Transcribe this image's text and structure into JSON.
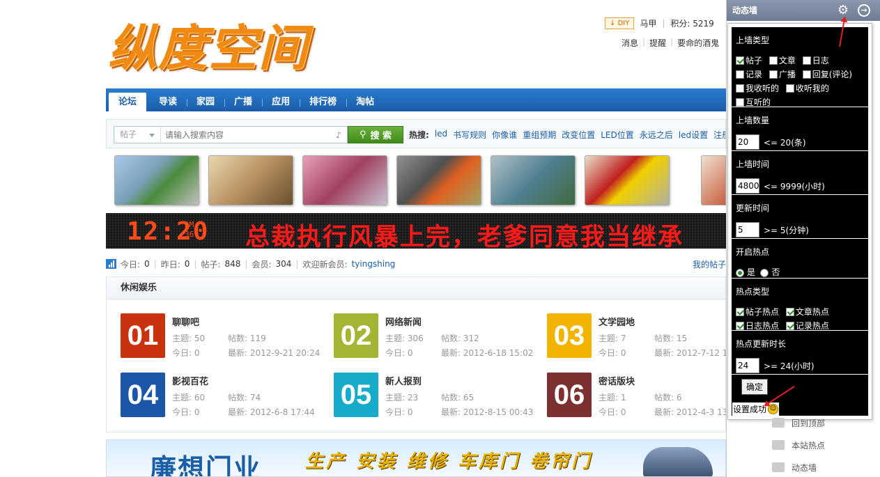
{
  "logo_text": "纵度空间",
  "userbar": {
    "diy": "DIY",
    "username": "马甲",
    "points": "积分: 5219",
    "links": [
      "消息",
      "提醒",
      "要命的酒鬼"
    ]
  },
  "nav": [
    "论坛",
    "导读",
    "家园",
    "广播",
    "应用",
    "排行榜",
    "淘帖"
  ],
  "search": {
    "type": "帖子",
    "placeholder": "请输入搜索内容",
    "button": "搜 索",
    "hot_label": "热搜:",
    "hot": [
      "led",
      "书写规则",
      "你像谁",
      "重组预期",
      "改变位置",
      "LED位置",
      "永远之后",
      "led设置",
      "注册"
    ]
  },
  "led": {
    "clock": "12:20",
    "ampm": "AM",
    "seconds": "36",
    "message": "总裁执行风暴上完，老爹同意我当继承"
  },
  "stats": {
    "today_label": "今日:",
    "today": "0",
    "yesterday_label": "昨日:",
    "yesterday": "0",
    "posts_label": "帖子:",
    "posts": "848",
    "members_label": "会员:",
    "members": "304",
    "welcome": "欢迎新会员:",
    "newuser": "tyingshing",
    "my_threads": "我的帖子"
  },
  "forum": {
    "title": "休闲娱乐",
    "boards": [
      {
        "num": "01",
        "name": "聊聊吧",
        "topics": "主题: 50",
        "posts": "帖数: 119",
        "today": "今日: 0",
        "latest": "最新: 2012-9-21 20:24",
        "color": "#c8320f"
      },
      {
        "num": "02",
        "name": "网络新闻",
        "topics": "主题: 306",
        "posts": "帖数: 312",
        "today": "今日: 0",
        "latest": "最新: 2012-6-18 15:02",
        "color": "#a3b532"
      },
      {
        "num": "03",
        "name": "文学园地",
        "topics": "主题: 7",
        "posts": "帖数: 15",
        "today": "今日: 0",
        "latest": "最新: 2012-7-12 1",
        "color": "#f2b400"
      },
      {
        "num": "04",
        "name": "影视百花",
        "topics": "主题: 60",
        "posts": "帖数: 74",
        "today": "今日: 0",
        "latest": "最新: 2012-6-8 17:44",
        "color": "#1c56a8"
      },
      {
        "num": "05",
        "name": "新人报到",
        "topics": "主题: 23",
        "posts": "帖数: 65",
        "today": "今日: 0",
        "latest": "最新: 2012-8-15 00:43",
        "color": "#16aacb"
      },
      {
        "num": "06",
        "name": "密话版块",
        "topics": "主题: 1",
        "posts": "帖数: 6",
        "today": "今日: 0",
        "latest": "最新: 2012-4-3 13",
        "color": "#7c3030"
      }
    ]
  },
  "ad": {
    "title": "廉想门业",
    "sub": "生产 安装 维修 车库门 卷帘门"
  },
  "side": {
    "title": "动态墙",
    "wall_type_title": "上墙类型",
    "wall_types": [
      {
        "label": "帖子",
        "checked": true
      },
      {
        "label": "文章",
        "checked": false
      },
      {
        "label": "日志",
        "checked": false
      },
      {
        "label": "记录",
        "checked": false
      },
      {
        "label": "广播",
        "checked": false
      },
      {
        "label": "回复(评论)",
        "checked": false
      },
      {
        "label": "我收听的",
        "checked": false
      },
      {
        "label": "收听我的",
        "checked": false
      },
      {
        "label": "互听的",
        "checked": false
      }
    ],
    "count_title": "上墙数量",
    "count_value": "20",
    "count_hint": "<= 20(条)",
    "time_title": "上墙时间",
    "time_value": "4800",
    "time_hint": "<= 9999(小时)",
    "update_title": "更新时间",
    "update_value": "5",
    "update_hint": ">= 5(分钟)",
    "hot_title": "开启热点",
    "hot_yes": "是",
    "hot_no": "否",
    "hot_type_title": "热点类型",
    "hot_types": [
      "帖子热点",
      "文章热点",
      "日志热点",
      "记录热点"
    ],
    "hot_update_title": "热点更新时长",
    "hot_update_value": "24",
    "hot_update_hint": ">= 24(小时)",
    "confirm": "确定",
    "success": "设置成功",
    "menu": [
      "回到顶部",
      "本站热点",
      "动态墙"
    ]
  }
}
